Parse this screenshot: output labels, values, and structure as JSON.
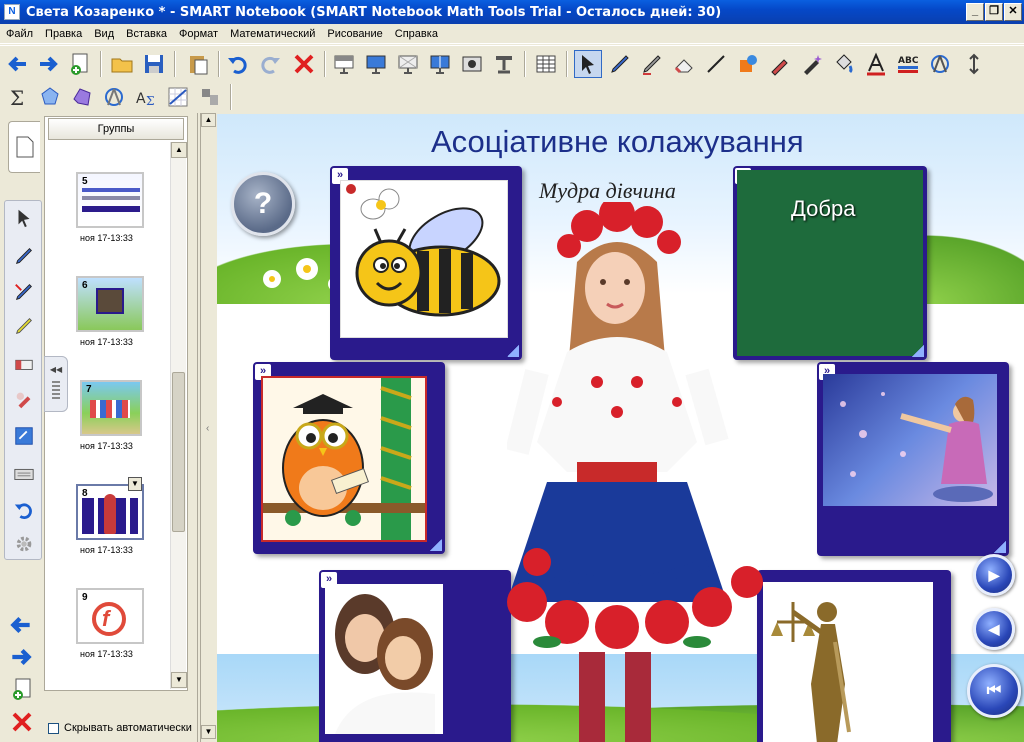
{
  "window": {
    "title": "Света Козаренко * - SMART Notebook (SMART Notebook Math Tools Trial - Осталось дней: 30)",
    "minimize": "_",
    "restore": "❐",
    "close": "✕"
  },
  "menu": [
    "Файл",
    "Правка",
    "Вид",
    "Вставка",
    "Формат",
    "Математический",
    "Рисование",
    "Справка"
  ],
  "toolbar_icons": [
    "back-arrow-icon",
    "forward-arrow-icon",
    "add-page-icon",
    "open-folder-icon",
    "save-icon",
    "paste-icon",
    "undo-icon",
    "redo-icon",
    "delete-icon",
    "screen-shade-icon",
    "full-screen-icon",
    "transparent-background-icon",
    "dual-page-icon",
    "capture-icon",
    "document-camera-icon",
    "table-icon",
    "select-icon",
    "pen-icon",
    "creative-pen-icon",
    "eraser-icon",
    "line-icon",
    "shapes-icon",
    "magic-pen-icon",
    "shape-pen-icon",
    "fill-icon",
    "text-icon",
    "properties-icon",
    "compass-icon",
    "move-toolbar-icon",
    "sum-icon",
    "regular-polygon-icon",
    "irregular-polygon-icon",
    "geometry-icon",
    "equation-icon",
    "graph-icon",
    "math-tools-icon"
  ],
  "sidebar": {
    "groups_label": "Группы",
    "pages": [
      {
        "number": "5",
        "date": "ноя 17-13:33"
      },
      {
        "number": "6",
        "date": "ноя 17-13:33"
      },
      {
        "number": "7",
        "date": "ноя 17-13:33"
      },
      {
        "number": "8",
        "date": "ноя 17-13:33"
      },
      {
        "number": "9",
        "date": "ноя 17-13:33"
      }
    ],
    "hide_auto_label": "Скрывать автоматически",
    "collapse_glyph": "◀◀"
  },
  "slide": {
    "title": "Асоціативне колажування",
    "subtitle": "Мудра дівчина",
    "answer": "Добра",
    "help_glyph": "?",
    "card_marker": "»"
  },
  "colors": {
    "title_blue": "#1c2f8a",
    "card_purple": "#2a1a8c",
    "answer_green": "#1e6b3c",
    "titlebar_blue": "#0548c8"
  }
}
